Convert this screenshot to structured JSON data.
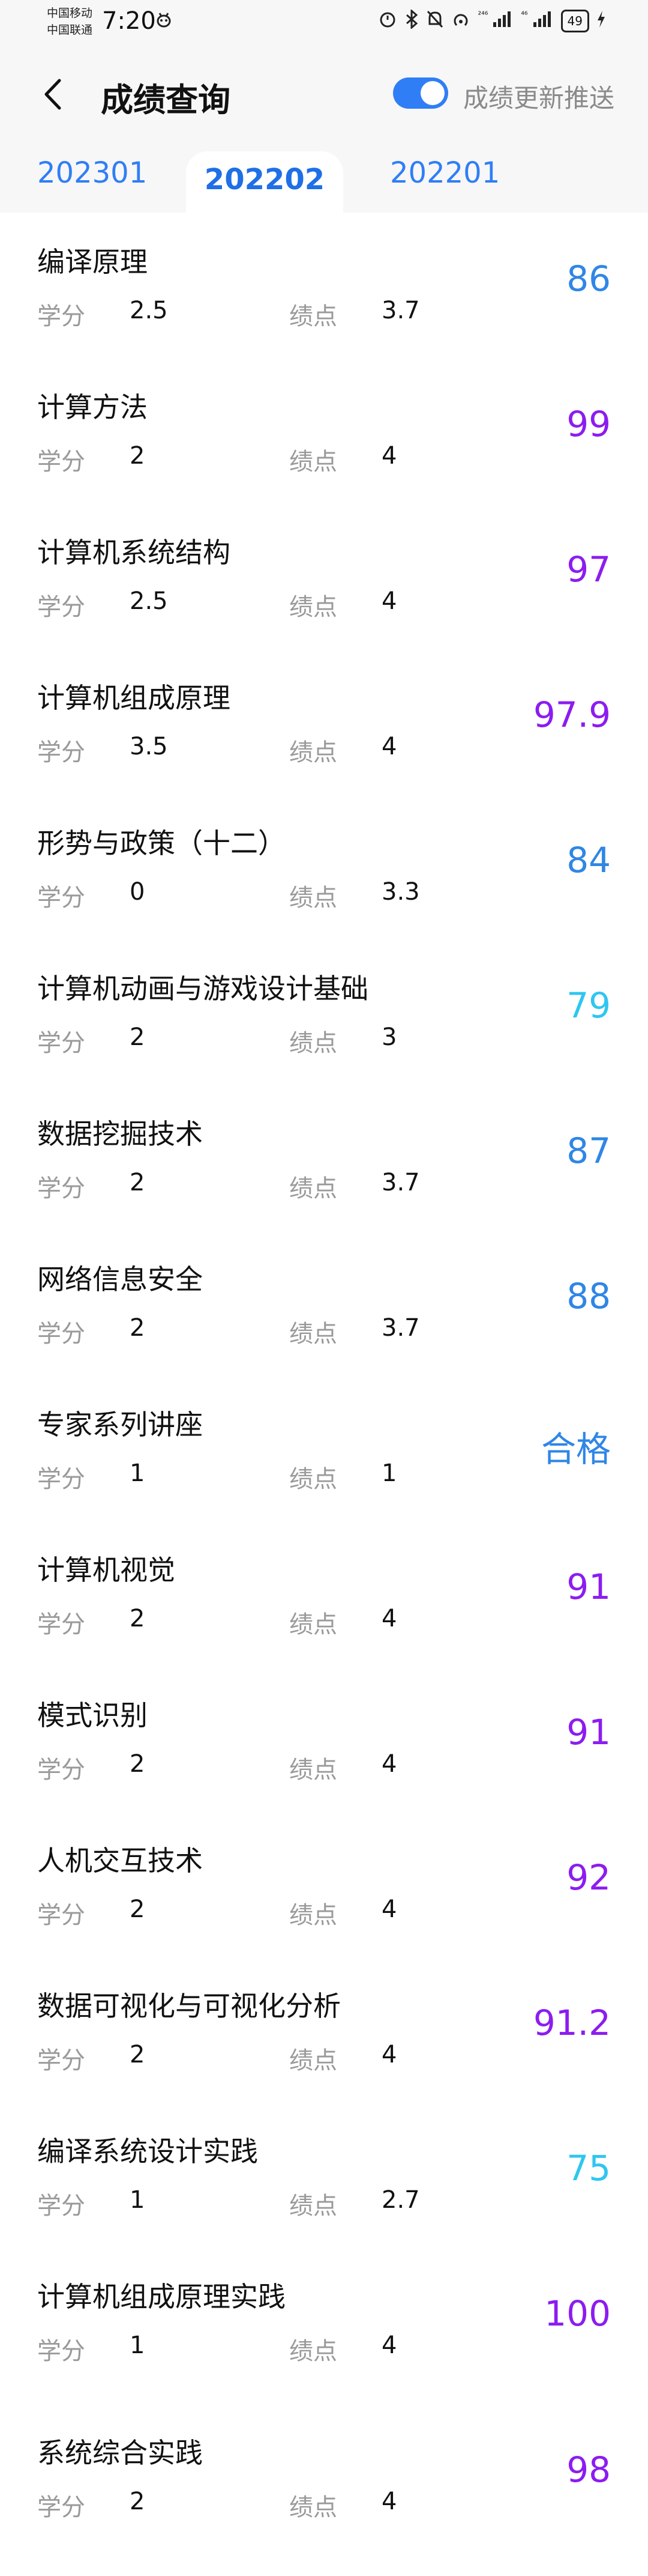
{
  "status_bar": {
    "carrier1": "中国移动",
    "carrier2": "中国联通",
    "time": "7:20",
    "battery": "49",
    "net1": "²⁴⁶",
    "net2": "⁴⁶"
  },
  "header": {
    "title": "成绩查询",
    "toggle_label": "成绩更新推送",
    "toggle_on": true
  },
  "tabs": [
    {
      "label": "202301",
      "active": false
    },
    {
      "label": "202202",
      "active": true
    },
    {
      "label": "202201",
      "active": false
    }
  ],
  "labels": {
    "credit": "学分",
    "grade_point": "绩点"
  },
  "colors": {
    "blue": "#2f86e6",
    "purple": "#8c1cf0",
    "cyan": "#2fc6f0"
  },
  "courses": [
    {
      "name": "编译原理",
      "credit": "2.5",
      "gp": "3.7",
      "score": "86",
      "color": "#2f86e6"
    },
    {
      "name": "计算方法",
      "credit": "2",
      "gp": "4",
      "score": "99",
      "color": "#8c1cf0"
    },
    {
      "name": "计算机系统结构",
      "credit": "2.5",
      "gp": "4",
      "score": "97",
      "color": "#8c1cf0"
    },
    {
      "name": "计算机组成原理",
      "credit": "3.5",
      "gp": "4",
      "score": "97.9",
      "color": "#8c1cf0"
    },
    {
      "name": "形势与政策（十二）",
      "credit": "0",
      "gp": "3.3",
      "score": "84",
      "color": "#2f86e6"
    },
    {
      "name": "计算机动画与游戏设计基础",
      "credit": "2",
      "gp": "3",
      "score": "79",
      "color": "#2fc6f0"
    },
    {
      "name": "数据挖掘技术",
      "credit": "2",
      "gp": "3.7",
      "score": "87",
      "color": "#2f86e6"
    },
    {
      "name": "网络信息安全",
      "credit": "2",
      "gp": "3.7",
      "score": "88",
      "color": "#2f86e6"
    },
    {
      "name": "专家系列讲座",
      "credit": "1",
      "gp": "1",
      "score": "合格",
      "color": "#2f86e6"
    },
    {
      "name": "计算机视觉",
      "credit": "2",
      "gp": "4",
      "score": "91",
      "color": "#8c1cf0"
    },
    {
      "name": "模式识别",
      "credit": "2",
      "gp": "4",
      "score": "91",
      "color": "#8c1cf0"
    },
    {
      "name": "人机交互技术",
      "credit": "2",
      "gp": "4",
      "score": "92",
      "color": "#8c1cf0"
    },
    {
      "name": "数据可视化与可视化分析",
      "credit": "2",
      "gp": "4",
      "score": "91.2",
      "color": "#8c1cf0"
    },
    {
      "name": "编译系统设计实践",
      "credit": "1",
      "gp": "2.7",
      "score": "75",
      "color": "#2fc6f0"
    },
    {
      "name": "计算机组成原理实践",
      "credit": "1",
      "gp": "4",
      "score": "100",
      "color": "#8c1cf0"
    },
    {
      "name": "系统综合实践",
      "credit": "2",
      "gp": "4",
      "score": "98",
      "color": "#8c1cf0"
    }
  ]
}
